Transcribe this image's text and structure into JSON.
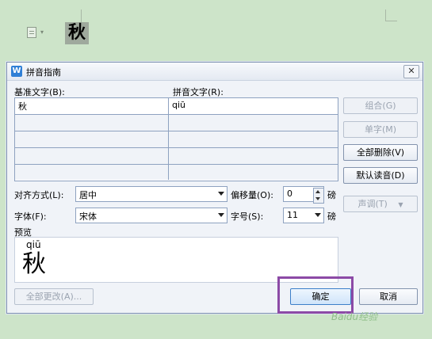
{
  "document": {
    "selected_char": "秋",
    "icon": "document-icon",
    "caret": "▾"
  },
  "dialog": {
    "app_icon_letter": "W",
    "title": "拼音指南",
    "close_label": "✕",
    "base_text_label": "基准文字(B):",
    "pinyin_text_label": "拼音文字(R):",
    "rows": [
      {
        "base": "秋",
        "pinyin": "qiū"
      },
      {
        "base": "",
        "pinyin": ""
      },
      {
        "base": "",
        "pinyin": ""
      },
      {
        "base": "",
        "pinyin": ""
      },
      {
        "base": "",
        "pinyin": ""
      }
    ],
    "buttons": {
      "combine": "组合(G)",
      "single_char": "单字(M)",
      "delete_all": "全部删除(V)",
      "default_reading": "默认读音(D)",
      "tone": "声调(T)",
      "change_all": "全部更改(A)...",
      "ok": "确定",
      "cancel": "取消"
    },
    "alignment_label": "对齐方式(L):",
    "alignment_value": "居中",
    "offset_label": "偏移量(O):",
    "offset_value": "0",
    "offset_unit": "磅",
    "font_label": "字体(F):",
    "font_value": "宋体",
    "size_label": "字号(S):",
    "size_value": "11",
    "size_unit": "磅",
    "preview_label": "预览",
    "preview_pinyin": "qiū",
    "preview_char": "秋"
  },
  "watermark": "Baidu经验",
  "colors": {
    "background": "#cde4c9",
    "dialog": "#f0f3f8",
    "highlight": "#8c4aa6"
  }
}
